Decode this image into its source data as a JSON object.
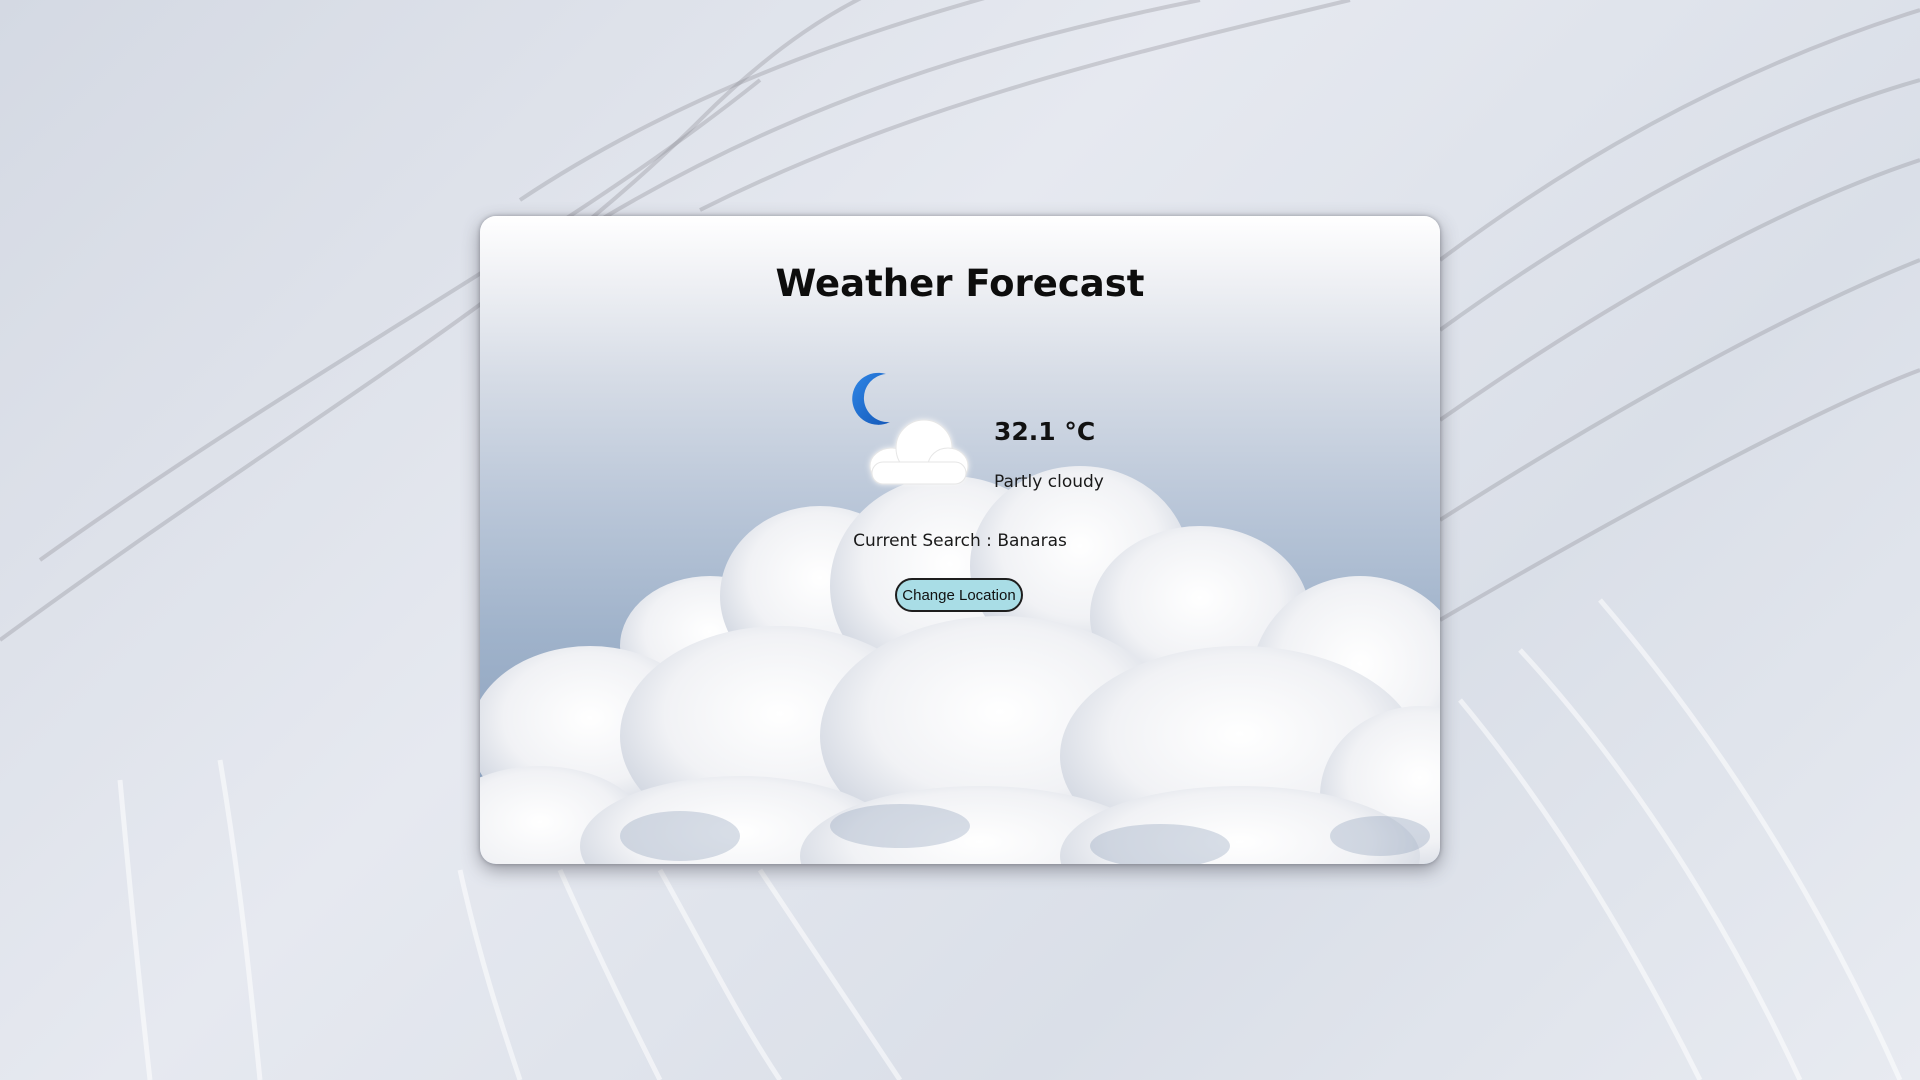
{
  "app": {
    "title": "Weather Forecast"
  },
  "weather": {
    "temperature": "32.1 °C",
    "condition": "Partly cloudy",
    "icon": "moon-cloud-icon"
  },
  "search": {
    "label": "Current Search : Banaras"
  },
  "actions": {
    "change_location_label": "Change Location"
  },
  "colors": {
    "button_bg": "#a9dde6",
    "moon": "#1e6fd1"
  }
}
